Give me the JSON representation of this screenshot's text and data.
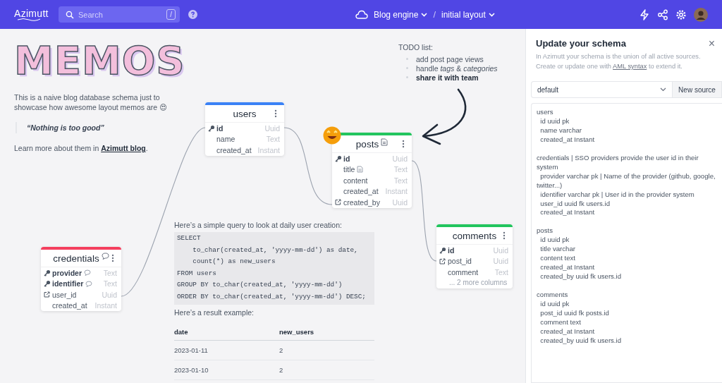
{
  "top_bar": {
    "logo": "Azimutt",
    "search": {
      "placeholder": "Search",
      "shortcut": "/"
    },
    "project": "Blog engine",
    "separator": "/",
    "layout": "initial layout"
  },
  "canvas": {
    "intro_memo": {
      "title": "MEMOS",
      "paragraph": "This is a naive blog database schema just to showcase how awesome layout memos are 😍",
      "quote": "“Nothing is too good”",
      "learn_more": {
        "text": "Learn more about them in ",
        "link": "Azimutt blog",
        "after": "."
      }
    },
    "todo_memo": {
      "title": "TODO list:",
      "items": [
        {
          "text": "add post page views",
          "bold": false
        },
        {
          "text": "handle *tags* & *categories*",
          "bold": false
        },
        {
          "text": "share it with team",
          "bold": true
        }
      ]
    },
    "tables": [
      {
        "name": "users",
        "color": "#3b82f6",
        "columns": [
          {
            "name": "id",
            "type": "Uuid",
            "kind": "pk"
          },
          {
            "name": "name",
            "type": "Text",
            "kind": "plain"
          },
          {
            "name": "created_at",
            "type": "Instant",
            "kind": "plain"
          }
        ]
      },
      {
        "name": "posts",
        "color": "#22c55e",
        "note": {
          "kind": "document"
        },
        "emoji": true,
        "columns": [
          {
            "name": "id",
            "type": "Uuid",
            "kind": "pk"
          },
          {
            "name": "title",
            "type": "Text",
            "kind": "plain",
            "note": {
              "kind": "document"
            }
          },
          {
            "name": "content",
            "type": "Text",
            "kind": "plain"
          },
          {
            "name": "created_at",
            "type": "Instant",
            "kind": "plain"
          },
          {
            "name": "created_by",
            "type": "Uuid",
            "kind": "fk"
          }
        ]
      },
      {
        "name": "credentials",
        "color": "#f43f5e",
        "note": {
          "kind": "comment"
        },
        "columns": [
          {
            "name": "provider",
            "type": "Text",
            "kind": "pk",
            "note": {
              "kind": "comment"
            }
          },
          {
            "name": "identifier",
            "type": "Text",
            "kind": "pk",
            "note": {
              "kind": "comment"
            }
          },
          {
            "name": "user_id",
            "type": "Uuid",
            "kind": "fk"
          },
          {
            "name": "created_at",
            "type": "Instant",
            "kind": "plain"
          }
        ]
      },
      {
        "name": "comments",
        "color": "#22c55e",
        "more": "... 2 more columns",
        "columns": [
          {
            "name": "id",
            "type": "Uuid",
            "kind": "pk"
          },
          {
            "name": "post_id",
            "type": "Uuid",
            "kind": "fk"
          },
          {
            "name": "comment",
            "type": "Text",
            "kind": "plain"
          }
        ]
      }
    ],
    "query_memo": {
      "intro": "Here’s a simple query to look at daily user creation:",
      "code": "SELECT\n    to_char(created_at, 'yyyy-mm-dd') as date,\n    count(*) as new_users\nFROM users\nGROUP BY to_char(created_at, 'yyyy-mm-dd')\nORDER BY to_char(created_at, 'yyyy-mm-dd') DESC;",
      "result_label": "Here’s a result example:",
      "result": {
        "columns": [
          "date",
          "new_users"
        ],
        "rows": [
          [
            "2023-01-11",
            "2"
          ],
          [
            "2023-01-10",
            "2"
          ]
        ]
      }
    }
  },
  "panel": {
    "title": "Update your schema",
    "close": "×",
    "description": {
      "text": "In Azimutt your schema is the union of all active sources. Create or update one with ",
      "link": "AML syntax",
      "after": " to extend it."
    },
    "source": "default",
    "new_source": "New source",
    "editor": "users\n  id uuid pk\n  name varchar\n  created_at Instant\n\ncredentials | SSO providers provide the user id in their system\n  provider varchar pk | Name of the provider (github, google, twitter...)\n  identifier varchar pk | User id in the provider system\n  user_id uuid fk users.id\n  created_at Instant\n\nposts\n  id uuid pk\n  title varchar\n  content text\n  created_at Instant\n  created_by uuid fk users.id\n\ncomments\n  id uuid pk\n  post_id uuid fk posts.id\n  comment text\n  created_at Instant\n  created_by uuid fk users.id"
  }
}
